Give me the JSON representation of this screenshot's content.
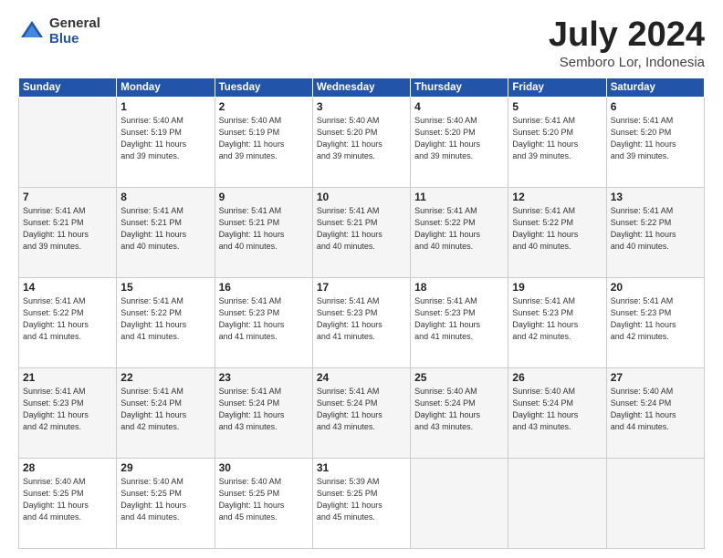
{
  "logo": {
    "general": "General",
    "blue": "Blue"
  },
  "title": "July 2024",
  "subtitle": "Semboro Lor, Indonesia",
  "days_of_week": [
    "Sunday",
    "Monday",
    "Tuesday",
    "Wednesday",
    "Thursday",
    "Friday",
    "Saturday"
  ],
  "weeks": [
    [
      {
        "day": "",
        "info": ""
      },
      {
        "day": "1",
        "info": "Sunrise: 5:40 AM\nSunset: 5:19 PM\nDaylight: 11 hours\nand 39 minutes."
      },
      {
        "day": "2",
        "info": "Sunrise: 5:40 AM\nSunset: 5:19 PM\nDaylight: 11 hours\nand 39 minutes."
      },
      {
        "day": "3",
        "info": "Sunrise: 5:40 AM\nSunset: 5:20 PM\nDaylight: 11 hours\nand 39 minutes."
      },
      {
        "day": "4",
        "info": "Sunrise: 5:40 AM\nSunset: 5:20 PM\nDaylight: 11 hours\nand 39 minutes."
      },
      {
        "day": "5",
        "info": "Sunrise: 5:41 AM\nSunset: 5:20 PM\nDaylight: 11 hours\nand 39 minutes."
      },
      {
        "day": "6",
        "info": "Sunrise: 5:41 AM\nSunset: 5:20 PM\nDaylight: 11 hours\nand 39 minutes."
      }
    ],
    [
      {
        "day": "7",
        "info": "Sunrise: 5:41 AM\nSunset: 5:21 PM\nDaylight: 11 hours\nand 39 minutes."
      },
      {
        "day": "8",
        "info": "Sunrise: 5:41 AM\nSunset: 5:21 PM\nDaylight: 11 hours\nand 40 minutes."
      },
      {
        "day": "9",
        "info": "Sunrise: 5:41 AM\nSunset: 5:21 PM\nDaylight: 11 hours\nand 40 minutes."
      },
      {
        "day": "10",
        "info": "Sunrise: 5:41 AM\nSunset: 5:21 PM\nDaylight: 11 hours\nand 40 minutes."
      },
      {
        "day": "11",
        "info": "Sunrise: 5:41 AM\nSunset: 5:22 PM\nDaylight: 11 hours\nand 40 minutes."
      },
      {
        "day": "12",
        "info": "Sunrise: 5:41 AM\nSunset: 5:22 PM\nDaylight: 11 hours\nand 40 minutes."
      },
      {
        "day": "13",
        "info": "Sunrise: 5:41 AM\nSunset: 5:22 PM\nDaylight: 11 hours\nand 40 minutes."
      }
    ],
    [
      {
        "day": "14",
        "info": "Sunrise: 5:41 AM\nSunset: 5:22 PM\nDaylight: 11 hours\nand 41 minutes."
      },
      {
        "day": "15",
        "info": "Sunrise: 5:41 AM\nSunset: 5:22 PM\nDaylight: 11 hours\nand 41 minutes."
      },
      {
        "day": "16",
        "info": "Sunrise: 5:41 AM\nSunset: 5:23 PM\nDaylight: 11 hours\nand 41 minutes."
      },
      {
        "day": "17",
        "info": "Sunrise: 5:41 AM\nSunset: 5:23 PM\nDaylight: 11 hours\nand 41 minutes."
      },
      {
        "day": "18",
        "info": "Sunrise: 5:41 AM\nSunset: 5:23 PM\nDaylight: 11 hours\nand 41 minutes."
      },
      {
        "day": "19",
        "info": "Sunrise: 5:41 AM\nSunset: 5:23 PM\nDaylight: 11 hours\nand 42 minutes."
      },
      {
        "day": "20",
        "info": "Sunrise: 5:41 AM\nSunset: 5:23 PM\nDaylight: 11 hours\nand 42 minutes."
      }
    ],
    [
      {
        "day": "21",
        "info": "Sunrise: 5:41 AM\nSunset: 5:23 PM\nDaylight: 11 hours\nand 42 minutes."
      },
      {
        "day": "22",
        "info": "Sunrise: 5:41 AM\nSunset: 5:24 PM\nDaylight: 11 hours\nand 42 minutes."
      },
      {
        "day": "23",
        "info": "Sunrise: 5:41 AM\nSunset: 5:24 PM\nDaylight: 11 hours\nand 43 minutes."
      },
      {
        "day": "24",
        "info": "Sunrise: 5:41 AM\nSunset: 5:24 PM\nDaylight: 11 hours\nand 43 minutes."
      },
      {
        "day": "25",
        "info": "Sunrise: 5:40 AM\nSunset: 5:24 PM\nDaylight: 11 hours\nand 43 minutes."
      },
      {
        "day": "26",
        "info": "Sunrise: 5:40 AM\nSunset: 5:24 PM\nDaylight: 11 hours\nand 43 minutes."
      },
      {
        "day": "27",
        "info": "Sunrise: 5:40 AM\nSunset: 5:24 PM\nDaylight: 11 hours\nand 44 minutes."
      }
    ],
    [
      {
        "day": "28",
        "info": "Sunrise: 5:40 AM\nSunset: 5:25 PM\nDaylight: 11 hours\nand 44 minutes."
      },
      {
        "day": "29",
        "info": "Sunrise: 5:40 AM\nSunset: 5:25 PM\nDaylight: 11 hours\nand 44 minutes."
      },
      {
        "day": "30",
        "info": "Sunrise: 5:40 AM\nSunset: 5:25 PM\nDaylight: 11 hours\nand 45 minutes."
      },
      {
        "day": "31",
        "info": "Sunrise: 5:39 AM\nSunset: 5:25 PM\nDaylight: 11 hours\nand 45 minutes."
      },
      {
        "day": "",
        "info": ""
      },
      {
        "day": "",
        "info": ""
      },
      {
        "day": "",
        "info": ""
      }
    ]
  ]
}
